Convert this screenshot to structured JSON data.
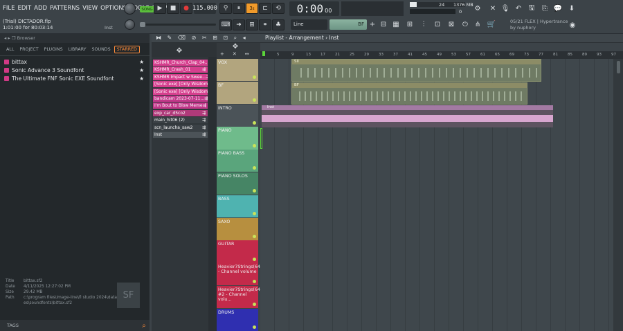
{
  "menu": [
    "FILE",
    "EDIT",
    "ADD",
    "PATTERNS",
    "VIEW",
    "OPTIONS",
    "TOOLS",
    "HELP"
  ],
  "title_line1": "(Trial) DICTADOR.flp",
  "title_line2": "1:01:00 for 80:03:14",
  "title_right": "Inst",
  "transport": {
    "song_label": "SONG",
    "tempo": "115.000",
    "time": "0:00",
    "time_small": "00",
    "pattern_select": "BF",
    "snap": "Line"
  },
  "meters": {
    "cpu": "24",
    "mem": "1376 MB",
    "mem2": "0"
  },
  "news": {
    "line1": "05/21  FLEX | Hypertrance",
    "line2": "by nuphory"
  },
  "browser": {
    "header": "Browser",
    "tabs": [
      "ALL",
      "PROJECT",
      "PLUGINS",
      "LIBRARY",
      "SOUNDS",
      "STARRED"
    ],
    "items": [
      "bittax",
      "Sonic Advance 3 Soundfont",
      "The Ultimate FNF Sonic EXE Soundfont"
    ],
    "info_labels": [
      "Title",
      "Date",
      "Size",
      "Path"
    ],
    "info_values": [
      "bittax.sf2",
      "4/11/2025 12:27:02 PM",
      "29.42 MB",
      "c:\\program files\\image-line\\fl studio 2024\\data\\patches\\soundfonts\\bittax.sf2"
    ],
    "tags": "TAGS"
  },
  "playlist_title": "Playlist - Arrangement › Inst",
  "picker": [
    {
      "label": "KSHMR_Church_Clap_04...",
      "color": "#d63f8e"
    },
    {
      "label": "KSHMR_Crash_01",
      "color": "#d63f8e"
    },
    {
      "label": "KSHMR Impact w Swee...",
      "color": "#d63f8e"
    },
    {
      "label": "[Sonic exe] [Only Wisdom]",
      "color": "#d63f8e"
    },
    {
      "label": "[Sonic exe] [Only Wisdom]",
      "color": "#d63f8e"
    },
    {
      "label": "bandicam 2023-07-11...",
      "color": "#c2378a"
    },
    {
      "label": "I'm Bout to Blow Meme",
      "color": "#c2378a"
    },
    {
      "label": "exp_car_d5co2",
      "color": "#b03a7a"
    },
    {
      "label": "main_hit06 (2)",
      "color": "#3a4045"
    },
    {
      "label": "scn_launcha_saw2",
      "color": "#3a4045"
    },
    {
      "label": "Inst",
      "color": "#4c5358"
    }
  ],
  "tracks": [
    {
      "name": "VOX",
      "color": "#b2a57e"
    },
    {
      "name": "BF",
      "color": "#b2a57e"
    },
    {
      "name": "INTRO",
      "color": "#4b5358"
    },
    {
      "name": "PIANO",
      "color": "#6fbb8b"
    },
    {
      "name": "PIANO BASS",
      "color": "#5aa57c"
    },
    {
      "name": "PIANO SOLOS",
      "color": "#468565"
    },
    {
      "name": "BASS",
      "color": "#4fb3b0"
    },
    {
      "name": "SAXO",
      "color": "#b78f3f"
    },
    {
      "name": "GUITAR",
      "color": "#c32a4a"
    },
    {
      "name": "Heavier7Strings(64) - Channel volume",
      "color": "#c32a4a"
    },
    {
      "name": "Heavier7Strings(64) #2 - Channel volu...",
      "color": "#c32a4a"
    },
    {
      "name": "DRUMS",
      "color": "#2f2fb0"
    }
  ],
  "ruler": [
    "5",
    "9",
    "13",
    "17",
    "21",
    "25",
    "29",
    "33",
    "37",
    "41",
    "45",
    "49",
    "53",
    "57",
    "61",
    "65",
    "69",
    "73",
    "77",
    "81",
    "85",
    "89",
    "93",
    "97"
  ],
  "clips": [
    {
      "label": "SII"
    },
    {
      "label": "BF"
    },
    {
      "label": "Inst"
    }
  ]
}
